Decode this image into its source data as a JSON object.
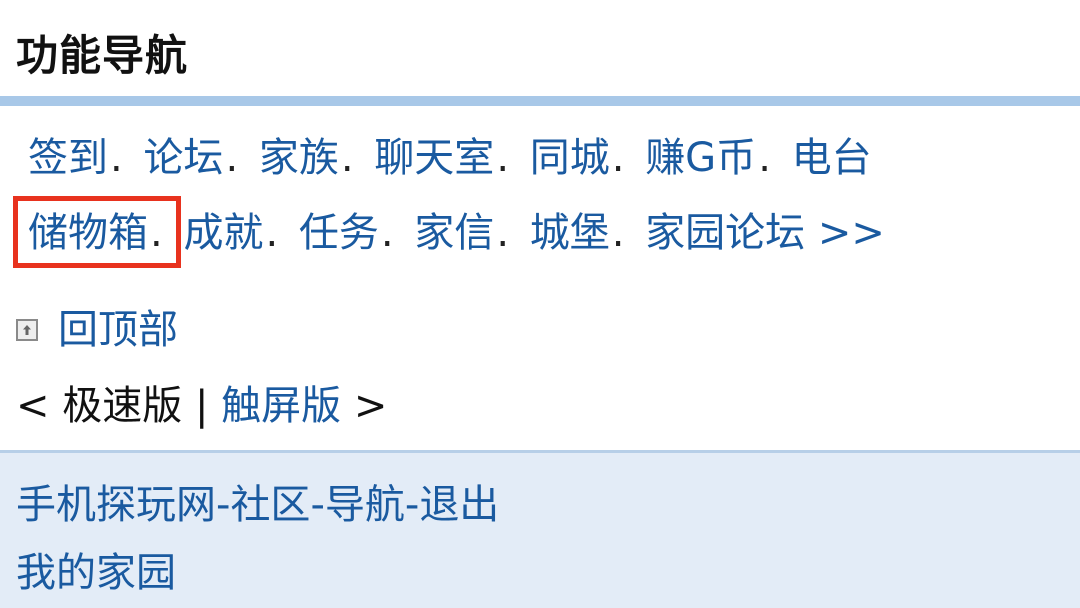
{
  "header": {
    "title": "功能导航"
  },
  "nav": {
    "row1": [
      {
        "label": "签到",
        "sep": "."
      },
      {
        "label": "论坛",
        "sep": "."
      },
      {
        "label": "家族",
        "sep": "."
      },
      {
        "label": "聊天室",
        "sep": "."
      },
      {
        "label": "同城",
        "sep": "."
      },
      {
        "label": "赚G币",
        "sep": "."
      },
      {
        "label": "电台",
        "sep": ""
      }
    ],
    "row2": [
      {
        "label": "储物箱",
        "sep": "."
      },
      {
        "label": "成就",
        "sep": "."
      },
      {
        "label": "任务",
        "sep": "."
      },
      {
        "label": "家信",
        "sep": "."
      },
      {
        "label": "城堡",
        "sep": "."
      },
      {
        "label": "家园论坛 >>",
        "sep": ""
      }
    ]
  },
  "back_to_top": {
    "icon": "arrow-up-box-icon",
    "label": "回顶部"
  },
  "version": {
    "open": "< ",
    "lite": "极速版",
    "divider": " | ",
    "touch": "触屏版",
    "close": " >"
  },
  "footer": {
    "breadcrumb": [
      "手机探玩网",
      "社区",
      "导航",
      "退出"
    ],
    "dash": "-",
    "home": "我的家园"
  },
  "colors": {
    "link": "#1a5aa0",
    "header_bar": "#a8c8e8",
    "footer_bg": "#e3ecf7",
    "highlight": "#e8321e"
  }
}
